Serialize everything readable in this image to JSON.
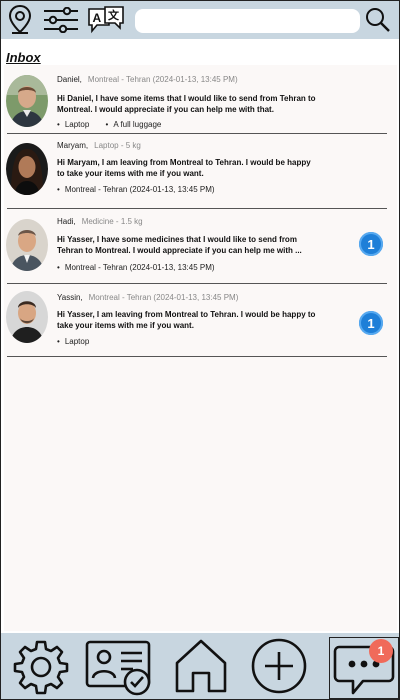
{
  "topbar": {
    "icons": [
      "location-pin-icon",
      "filter-sliders-icon",
      "translate-icon",
      "search-icon"
    ],
    "search": {
      "value": "",
      "placeholder": ""
    }
  },
  "inbox": {
    "title": "Inbox"
  },
  "messages": [
    {
      "name": "Daniel,",
      "sub": "Montreal - Tehran (2024-01-13, 13:45 PM)",
      "text": "Hi Daniel,  I have some items that I would like to send from Tehran to Montreal. I would appreciate if you can help me with that.",
      "bullets": [
        "Laptop",
        "A full luggage"
      ],
      "badge": ""
    },
    {
      "name": "Maryam,",
      "sub": "Laptop - 5 kg",
      "text": "Hi Maryam, I am leaving from Montreal to Tehran. I would be happy to take your items with me if you want.",
      "bullets": [
        "Montreal - Tehran (2024-01-13, 13:45 PM)"
      ],
      "badge": ""
    },
    {
      "name": "Hadi,",
      "sub": "Medicine - 1.5 kg",
      "text": "Hi Yasser,  I have some medicines that I would like to send from Tehran to Montreal. I would appreciate if you can help me with ...",
      "bullets": [
        "Montreal - Tehran (2024-01-13, 13:45 PM)"
      ],
      "badge": "1"
    },
    {
      "name": "Yassin,",
      "sub": "Montreal - Tehran (2024-01-13, 13:45 PM)",
      "text": "Hi Yasser,  I am leaving from Montreal to Tehran. I would be happy to take your items with me if you want.",
      "bullets": [
        "Laptop"
      ],
      "badge": "1"
    }
  ],
  "bottombar": {
    "icons": [
      "settings-gear-icon",
      "id-card-check-icon",
      "home-icon",
      "add-circle-icon",
      "chat-bubble-icon"
    ],
    "chat_badge": "1"
  },
  "colors": {
    "bar": "#c8d6e0",
    "badge": "#1e7fd8",
    "notification": "#f06a5a",
    "content_bg": "#fbf8f7"
  }
}
